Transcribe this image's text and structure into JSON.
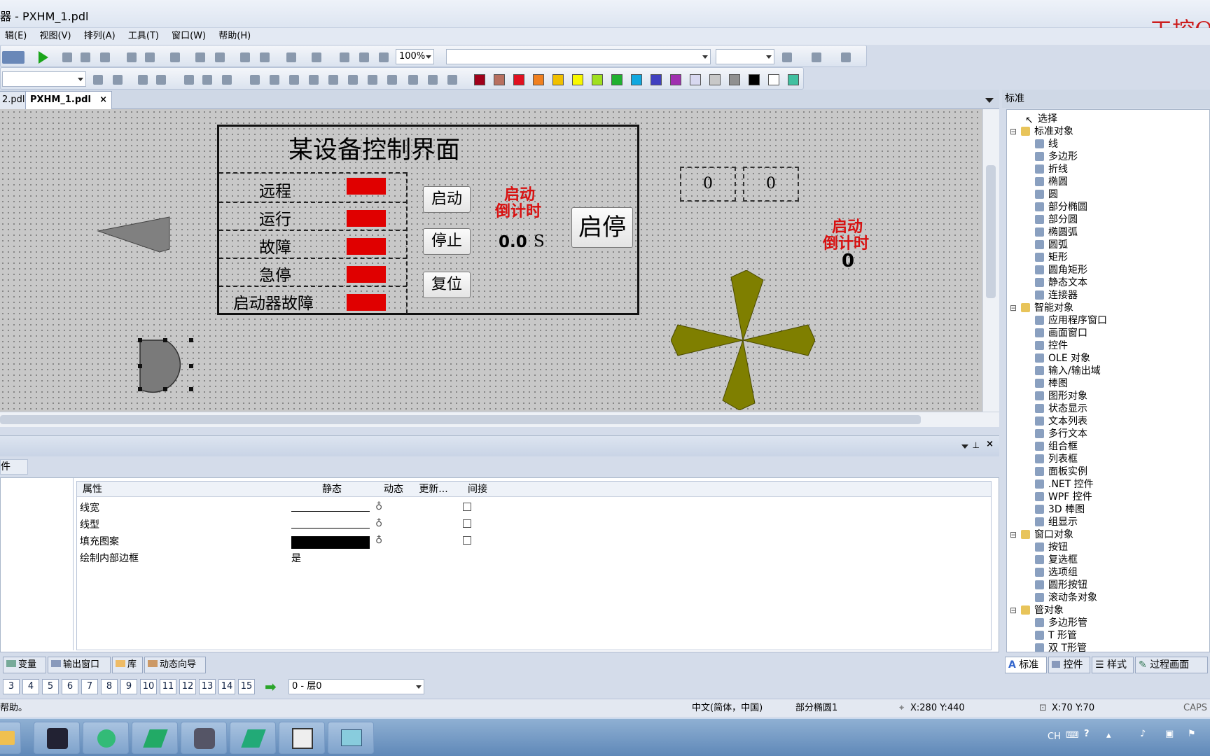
{
  "window": {
    "title": "器 - PXHM_1.pdl",
    "brand_text": "工控Q"
  },
  "menu": [
    "辑(E)",
    "视图(V)",
    "排列(A)",
    "工具(T)",
    "窗口(W)",
    "帮助(H)"
  ],
  "toolbar": {
    "zoom": "100%"
  },
  "colors": {
    "palette": [
      "#a0001a",
      "#b87060",
      "#e01020",
      "#f08020",
      "#f0c000",
      "#f8f800",
      "#a0e020",
      "#20b030",
      "#10a8e0",
      "#4040c0",
      "#a030b0",
      "#d8d8f0",
      "#c8c8c8",
      "#909090",
      "#000000",
      "#ffffff",
      "#40c0a0"
    ]
  },
  "tabs": [
    "2.pdl",
    "PXHM_1.pdl"
  ],
  "hmi": {
    "title": "某设备控制界面",
    "status_rows": [
      "远程",
      "运行",
      "故障",
      "急停",
      "启动器故障"
    ],
    "buttons": {
      "start": "启动",
      "stop": "停止",
      "reset": "复位",
      "startstop": "启停"
    },
    "countdown_label_1": "启动",
    "countdown_label_2": "倒计时",
    "countdown_value": "0.0",
    "countdown_unit": "S",
    "io_field_1": "0",
    "io_field_2": "0",
    "right_label_1": "启动",
    "right_label_2": "倒计时",
    "right_value": "0"
  },
  "panel": {
    "tab": "件",
    "headers": [
      "属性",
      "静态",
      "动态",
      "更新...",
      "间接"
    ],
    "rows": [
      {
        "name": "线宽",
        "static": ""
      },
      {
        "name": "线型",
        "static": ""
      },
      {
        "name": "填充图案",
        "static": ""
      },
      {
        "name": "绘制内部边框",
        "static": "是"
      }
    ]
  },
  "bottom_tabs": [
    "变量",
    "输出窗口",
    "库",
    "动态向导"
  ],
  "layers": {
    "numbers": [
      "3",
      "4",
      "5",
      "6",
      "7",
      "8",
      "9",
      "10",
      "11",
      "12",
      "13",
      "14",
      "15"
    ],
    "current": "0 - 层0"
  },
  "status": {
    "help": "帮助。",
    "language": "中文(简体，中国)",
    "object": "部分椭圆1",
    "position": "X:280 Y:440",
    "size": "X:70 Y:70",
    "caps": "CAPS"
  },
  "right_panel": {
    "header": "标准",
    "tree": [
      {
        "label": "选择",
        "level": 1
      },
      {
        "label": "标准对象",
        "level": 0
      },
      {
        "label": "线",
        "level": 2
      },
      {
        "label": "多边形",
        "level": 2
      },
      {
        "label": "折线",
        "level": 2
      },
      {
        "label": "椭圆",
        "level": 2
      },
      {
        "label": "圆",
        "level": 2
      },
      {
        "label": "部分椭圆",
        "level": 2
      },
      {
        "label": "部分圆",
        "level": 2
      },
      {
        "label": "椭圆弧",
        "level": 2
      },
      {
        "label": "圆弧",
        "level": 2
      },
      {
        "label": "矩形",
        "level": 2
      },
      {
        "label": "圆角矩形",
        "level": 2
      },
      {
        "label": "静态文本",
        "level": 2
      },
      {
        "label": "连接器",
        "level": 2
      },
      {
        "label": "智能对象",
        "level": 0
      },
      {
        "label": "应用程序窗口",
        "level": 2
      },
      {
        "label": "画面窗口",
        "level": 2
      },
      {
        "label": "控件",
        "level": 2
      },
      {
        "label": "OLE 对象",
        "level": 2
      },
      {
        "label": "输入/输出域",
        "level": 2
      },
      {
        "label": "棒图",
        "level": 2
      },
      {
        "label": "图形对象",
        "level": 2
      },
      {
        "label": "状态显示",
        "level": 2
      },
      {
        "label": "文本列表",
        "level": 2
      },
      {
        "label": "多行文本",
        "level": 2
      },
      {
        "label": "组合框",
        "level": 2
      },
      {
        "label": "列表框",
        "level": 2
      },
      {
        "label": "面板实例",
        "level": 2
      },
      {
        "label": ".NET 控件",
        "level": 2
      },
      {
        "label": "WPF 控件",
        "level": 2
      },
      {
        "label": "3D 棒图",
        "level": 2
      },
      {
        "label": "组显示",
        "level": 2
      },
      {
        "label": "窗口对象",
        "level": 0
      },
      {
        "label": "按钮",
        "level": 2
      },
      {
        "label": "复选框",
        "level": 2
      },
      {
        "label": "选项组",
        "level": 2
      },
      {
        "label": "圆形按钮",
        "level": 2
      },
      {
        "label": "滚动条对象",
        "level": 2
      },
      {
        "label": "管对象",
        "level": 0
      },
      {
        "label": "多边形管",
        "level": 2
      },
      {
        "label": "T 形管",
        "level": 2
      },
      {
        "label": "双 T形管",
        "level": 2
      }
    ],
    "tabs": [
      "标准",
      "控件",
      "样式",
      "过程画面"
    ]
  },
  "taskbar": {
    "tray_lang": "CH"
  }
}
